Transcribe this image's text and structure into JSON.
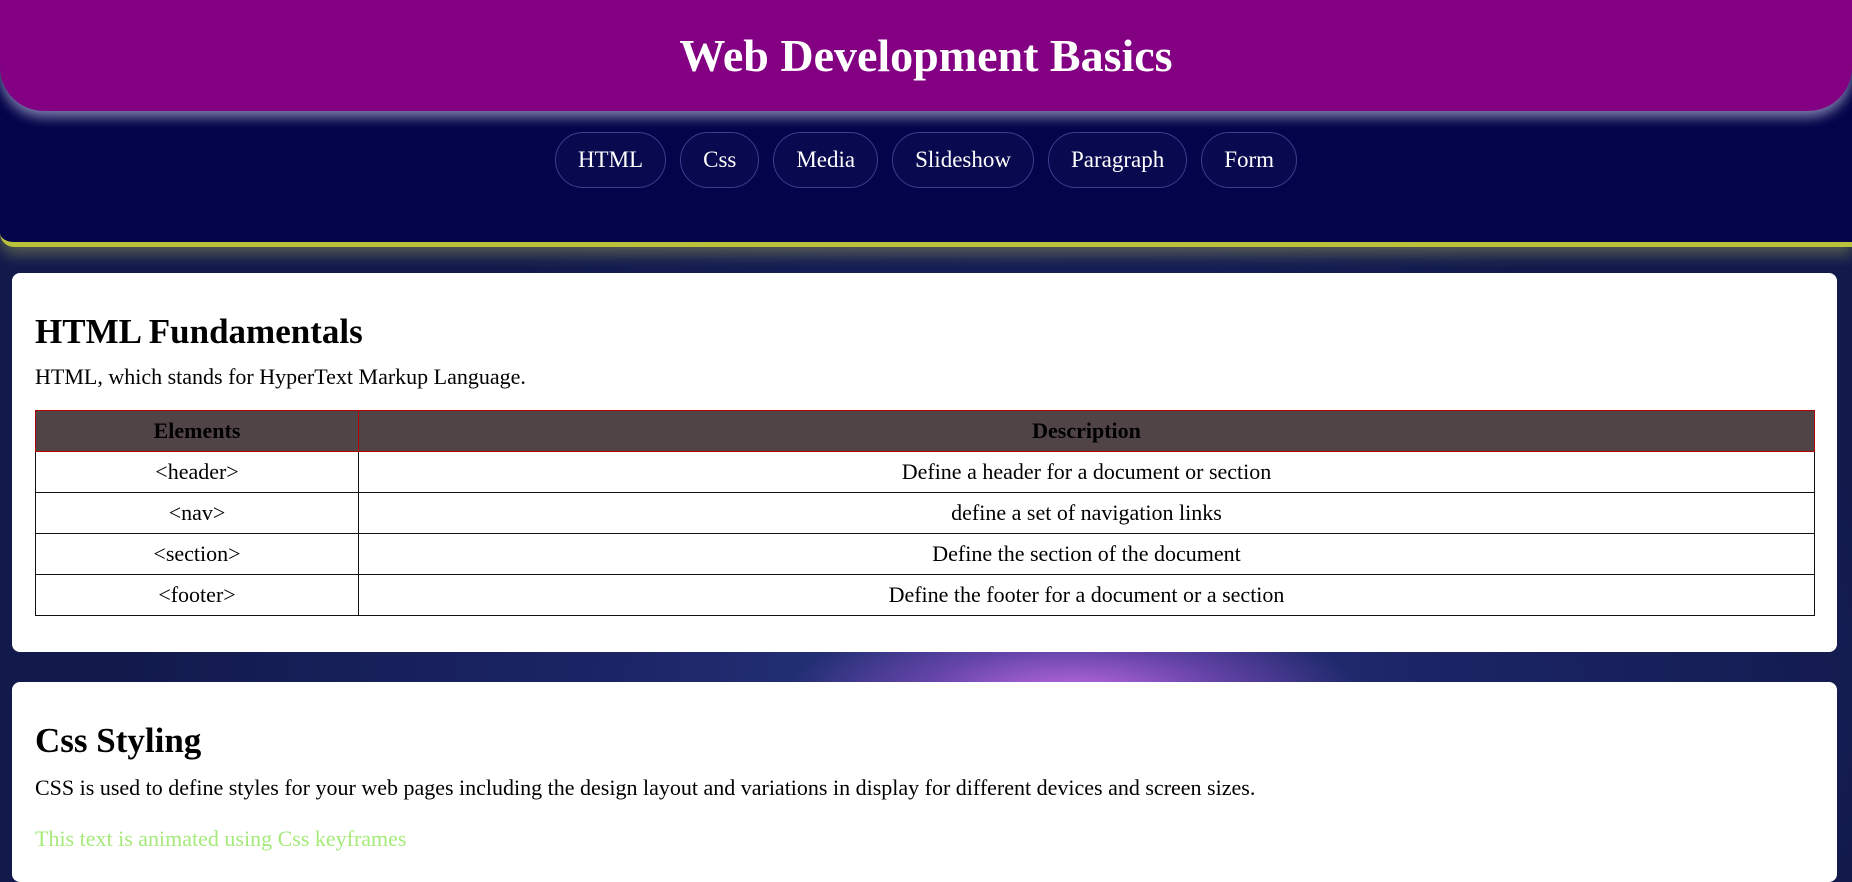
{
  "header": {
    "title": "Web Development Basics"
  },
  "nav": {
    "items": [
      {
        "label": "HTML"
      },
      {
        "label": "Css"
      },
      {
        "label": "Media"
      },
      {
        "label": "Slideshow"
      },
      {
        "label": "Paragraph"
      },
      {
        "label": "Form"
      }
    ]
  },
  "html_section": {
    "heading": "HTML Fundamentals",
    "intro": "HTML, which stands for HyperText Markup Language.",
    "table": {
      "headers": [
        "Elements",
        "Description"
      ],
      "rows": [
        {
          "element": "<header>",
          "description": "Define a header for a document or section"
        },
        {
          "element": "<nav>",
          "description": "define a set of navigation links"
        },
        {
          "element": "<section>",
          "description": "Define the section of the document"
        },
        {
          "element": "<footer>",
          "description": "Define the footer for a document or a section"
        }
      ]
    }
  },
  "css_section": {
    "heading": "Css Styling",
    "intro": "CSS is used to define styles for your web pages including the design layout and variations in display for different devices and screen sizes.",
    "animated_text": "This text is animated using Css keyframes"
  },
  "colors": {
    "header_bg": "#830083",
    "nav_band_bg": "#04044a",
    "band_accent": "#b9c23a",
    "table_header_bg": "#504447",
    "table_header_border": "#b00000",
    "animated_text": "#a6ea7b"
  }
}
